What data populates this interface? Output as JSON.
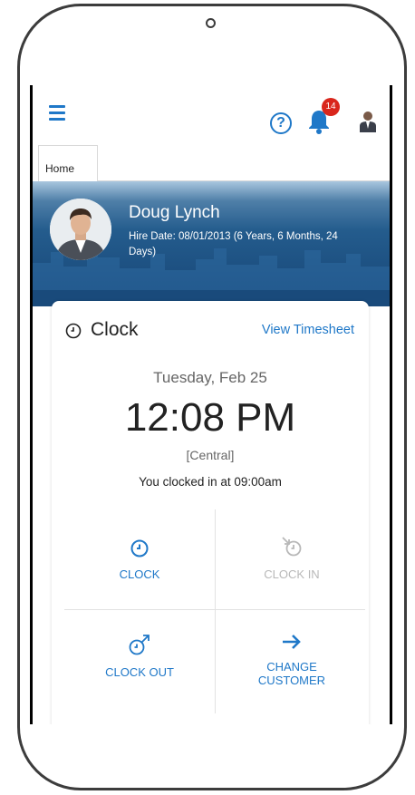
{
  "header": {
    "notification_count": "14"
  },
  "tabs": [
    {
      "label": "Home"
    }
  ],
  "profile": {
    "name": "Doug Lynch",
    "hire_date": "Hire Date: 08/01/2013 (6 Years, 6 Months, 24 Days)"
  },
  "clock_card": {
    "title": "Clock",
    "view_timesheet": "View Timesheet",
    "date": "Tuesday, Feb 25",
    "time": "12:08 PM",
    "timezone": "[Central]",
    "clocked_in_status": "You clocked in at 09:00am",
    "actions": [
      {
        "label": "CLOCK",
        "icon": "clock-icon",
        "enabled": true
      },
      {
        "label": "CLOCK IN",
        "icon": "clock-in-icon",
        "enabled": false
      },
      {
        "label": "CLOCK OUT",
        "icon": "clock-out-icon",
        "enabled": true
      },
      {
        "label_line1": "CHANGE",
        "label_line2": "CUSTOMER",
        "icon": "arrow-right-icon",
        "enabled": true
      }
    ]
  },
  "colors": {
    "accent": "#1f78c8",
    "badge": "#d9261c",
    "hero_dark": "#194a7b",
    "disabled": "#b8b8b8"
  }
}
